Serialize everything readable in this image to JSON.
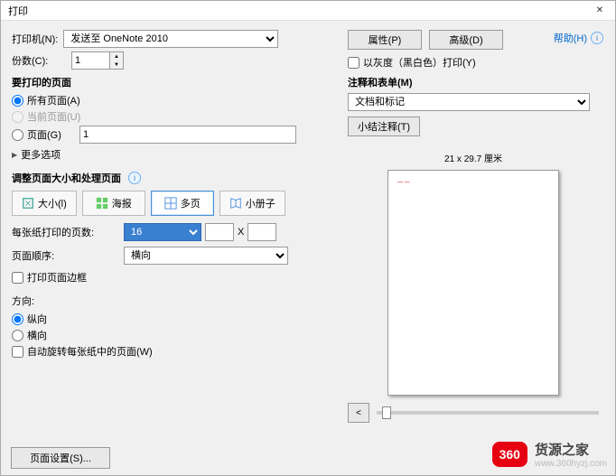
{
  "window": {
    "title": "打印",
    "close": "✕"
  },
  "help": {
    "label": "帮助(H)"
  },
  "printer": {
    "label": "打印机(N):",
    "selected": "发送至 OneNote 2010",
    "properties": "属性(P)",
    "advanced": "高级(D)"
  },
  "copies": {
    "label": "份数(C):",
    "value": "1"
  },
  "grayscale": {
    "label": "以灰度（黑白色）打印(Y)"
  },
  "comments": {
    "title": "注释和表单(M)",
    "selected": "文档和标记",
    "summarize": "小结注释(T)"
  },
  "pages": {
    "title": "要打印的页面",
    "all": "所有页面(A)",
    "current": "当前页面(U)",
    "range": "页面(G)",
    "range_value": "1",
    "more": "更多选项"
  },
  "sizing": {
    "title": "调整页面大小和处理页面",
    "tabs": {
      "size": "大小(l)",
      "poster": "海报",
      "multi": "多页",
      "booklet": "小册子"
    }
  },
  "multi": {
    "pages_per_label": "每张纸打印的页数:",
    "pages_per_value": "16",
    "x": "X",
    "order_label": "页面顺序:",
    "order_value": "横向",
    "border": "打印页面边框"
  },
  "orientation": {
    "title": "方向:",
    "portrait": "纵向",
    "landscape": "横向",
    "autorotate": "自动旋转每张纸中的页面(W)"
  },
  "preview": {
    "caption": "21 x 29.7 厘米"
  },
  "footer": {
    "page_setup": "页面设置(S)..."
  },
  "nav": {
    "prev": "<"
  },
  "watermark": {
    "badge": "360",
    "text": "货源之家",
    "sub": "www.360hyzj.com"
  }
}
